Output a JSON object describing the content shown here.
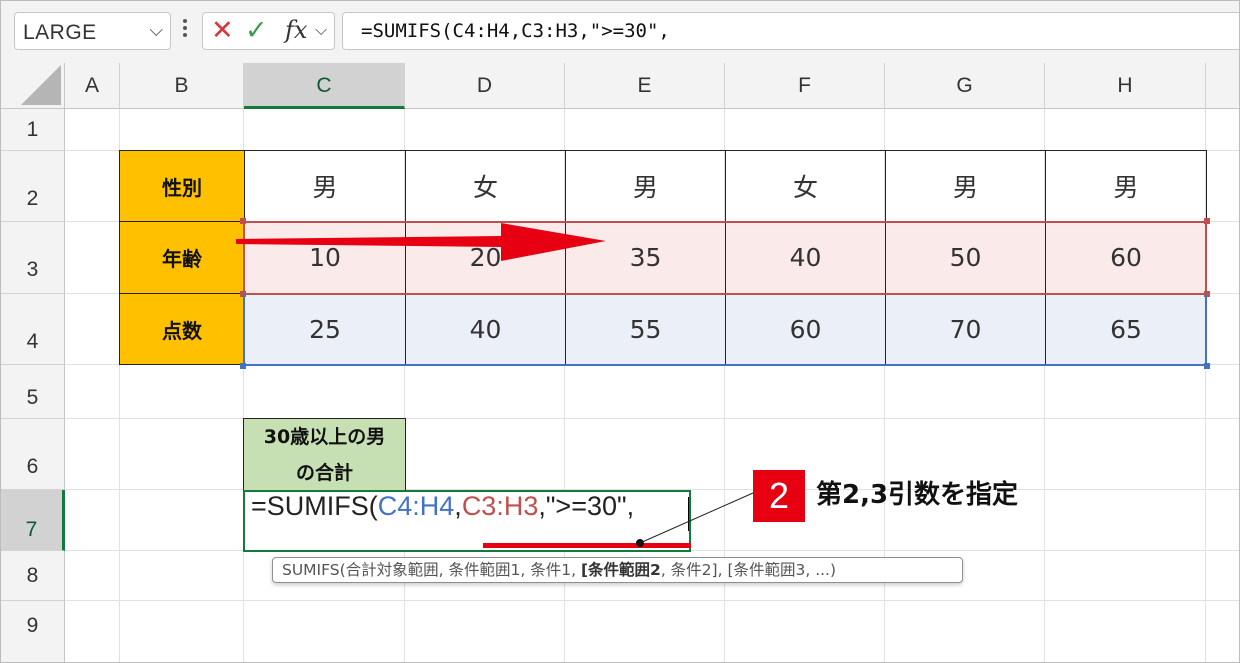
{
  "formula_bar": {
    "name_box": "LARGE",
    "cancel_icon": "✕",
    "enter_icon": "✓",
    "fx_label": "fx",
    "formula": "=SUMIFS(C4:H4,C3:H3,\">=30\","
  },
  "columns": [
    "A",
    "B",
    "C",
    "D",
    "E",
    "F",
    "G",
    "H"
  ],
  "rows": [
    "1",
    "2",
    "3",
    "4",
    "5",
    "6",
    "7",
    "8",
    "9"
  ],
  "table": {
    "labels": [
      "性別",
      "年齢",
      "点数"
    ],
    "gender": [
      "男",
      "女",
      "男",
      "女",
      "男",
      "男"
    ],
    "age": [
      "10",
      "20",
      "35",
      "40",
      "50",
      "60"
    ],
    "score": [
      "25",
      "40",
      "55",
      "60",
      "70",
      "65"
    ]
  },
  "summary_label": {
    "line1": "30歳以上の男",
    "line2": "の合計"
  },
  "edit_cell": {
    "prefix": "=SUMIFS(",
    "arg1": "C4:H4",
    "sep1": ",",
    "arg2": "C3:H3",
    "rest": ",\">=30\","
  },
  "tooltip": {
    "before": "SUMIFS(合計対象範囲, 条件範囲1, 条件1, ",
    "bold": "[条件範囲2",
    "after": ", 条件2], [条件範囲3, ...)"
  },
  "annotation": {
    "badge": "2",
    "text": "第2,3引数を指定"
  },
  "colors": {
    "label_fill": "#ffc000",
    "summary_fill": "#c6e0b4",
    "accent_red": "#e60012",
    "ref_blue": "#4472c4",
    "ref_red": "#c0504d",
    "select_green": "#137a3d"
  }
}
